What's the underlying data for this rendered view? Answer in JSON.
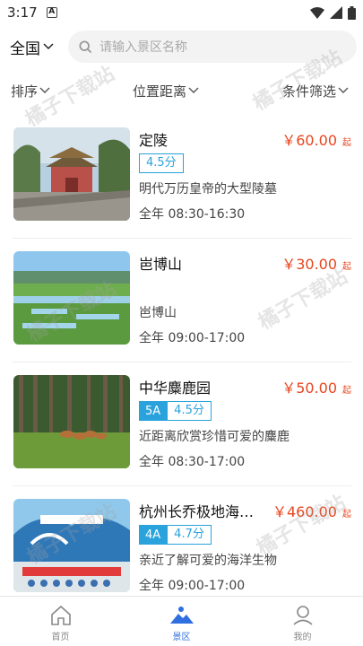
{
  "status_bar": {
    "time": "3:17",
    "badge": "A"
  },
  "header": {
    "city": "全国",
    "search_placeholder": "请输入景区名称"
  },
  "filters": {
    "sort": "排序",
    "distance": "位置距离",
    "conditions": "条件筛选"
  },
  "price_suffix": "起",
  "spots": [
    {
      "name": "定陵",
      "price": "￥60.00",
      "level": "",
      "score": "4.5分",
      "desc": "明代万历皇帝的大型陵墓",
      "hours": "全年 08:30-16:30"
    },
    {
      "name": "岜博山",
      "price": "￥30.00",
      "level": "",
      "score": "",
      "desc": "岜博山",
      "hours": "全年 09:00-17:00"
    },
    {
      "name": "中华麋鹿园",
      "price": "￥50.00",
      "level": "5A",
      "score": "4.5分",
      "desc": "近距离欣赏珍惜可爱的麋鹿",
      "hours": "全年 08:30-17:00"
    },
    {
      "name": "杭州长乔极地海…",
      "price": "￥460.00",
      "level": "4A",
      "score": "4.7分",
      "desc": "亲近了解可爱的海洋生物",
      "hours": "全年 09:00-17:00"
    }
  ],
  "tabs": [
    {
      "label": "首页",
      "icon": "home-icon",
      "active": false
    },
    {
      "label": "景区",
      "icon": "mountain-icon",
      "active": true
    },
    {
      "label": "我的",
      "icon": "user-icon",
      "active": false
    }
  ],
  "watermark": "橘子下载站",
  "colors": {
    "price": "#e8451e",
    "tag": "#2aa2dc",
    "active_tab": "#2f6fe0"
  }
}
